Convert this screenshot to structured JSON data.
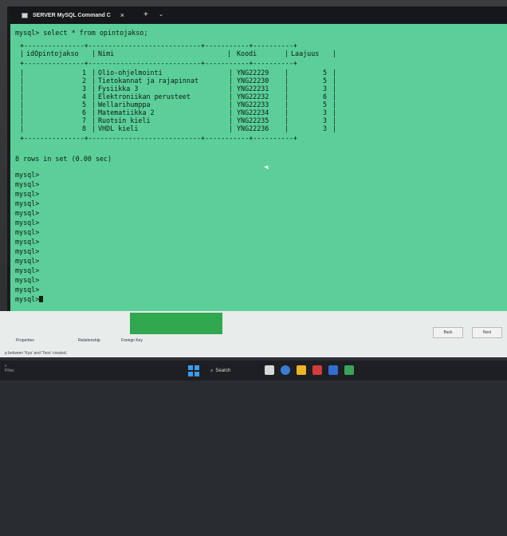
{
  "window": {
    "tab_title": "SERVER MySQL Command C",
    "close_glyph": "×",
    "newtab_glyph": "+",
    "dropdown_glyph": "⌄"
  },
  "console": {
    "command": "mysql> select * from opintojakso;",
    "separator": "+---------------+----------------------------+-----------+----------+",
    "headers": [
      "idOpintojakso",
      "Nimi",
      "Koodi",
      "Laajuus"
    ],
    "rows": [
      {
        "id": "1",
        "nimi": "Olio-ohjelmointi",
        "koodi": "YNG22229",
        "laajuus": "5"
      },
      {
        "id": "2",
        "nimi": "Tietokannat ja rajapinnat",
        "koodi": "YNG22230",
        "laajuus": "5"
      },
      {
        "id": "3",
        "nimi": "Fysiikka 3",
        "koodi": "YNG22231",
        "laajuus": "3"
      },
      {
        "id": "4",
        "nimi": "Elektroniikan perusteet",
        "koodi": "YNG22232",
        "laajuus": "6"
      },
      {
        "id": "5",
        "nimi": "Wellarihumppa",
        "koodi": "YNG22233",
        "laajuus": "5"
      },
      {
        "id": "6",
        "nimi": "Matematiikka 2",
        "koodi": "YNG22234",
        "laajuus": "3"
      },
      {
        "id": "7",
        "nimi": "Ruotsin kieli",
        "koodi": "YNG22235",
        "laajuus": "3"
      },
      {
        "id": "8",
        "nimi": "VHDL kieli",
        "koodi": "YNG22236",
        "laajuus": "3"
      }
    ],
    "result": "8 rows in set (0.00 sec)",
    "prompts": [
      "mysql>",
      "mysql>",
      "mysql>",
      "mysql>",
      "mysql>",
      "mysql>",
      "mysql>",
      "mysql>",
      "mysql>",
      "mysql>",
      "mysql>",
      "mysql>",
      "mysql>",
      "mysql>"
    ]
  },
  "underlay": {
    "tabs": [
      "Properties",
      "Relationship",
      "Foreign Key"
    ],
    "status": "p between 'Kya' and 'Teos' created.",
    "back_label": "Back",
    "next_label": "Next"
  },
  "taskbar": {
    "left_lines": [
      "c",
      "Pilvis"
    ],
    "search_label": "Search"
  },
  "colors": {
    "terminal_bg": "#5ccf99",
    "text": "#0b1c14",
    "titlebar": "#15171a",
    "accent_green": "#2fa84f"
  }
}
